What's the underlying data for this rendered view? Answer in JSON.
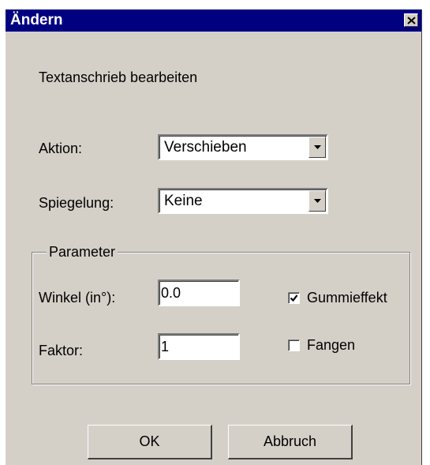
{
  "window": {
    "title": "Ändern",
    "close_icon": "close-icon"
  },
  "heading": "Textanschrieb bearbeiten",
  "aktion": {
    "label": "Aktion:",
    "value": "Verschieben"
  },
  "spiegelung": {
    "label": "Spiegelung:",
    "value": "Keine"
  },
  "parameter": {
    "group_title": "Parameter",
    "winkel_label": "Winkel (in°):",
    "winkel_value": "0.0",
    "faktor_label": "Faktor:",
    "faktor_value": "1",
    "gummieffekt_label": "Gummieffekt",
    "gummieffekt_checked": true,
    "fangen_label": "Fangen",
    "fangen_checked": false
  },
  "buttons": {
    "ok": "OK",
    "cancel": "Abbruch"
  }
}
